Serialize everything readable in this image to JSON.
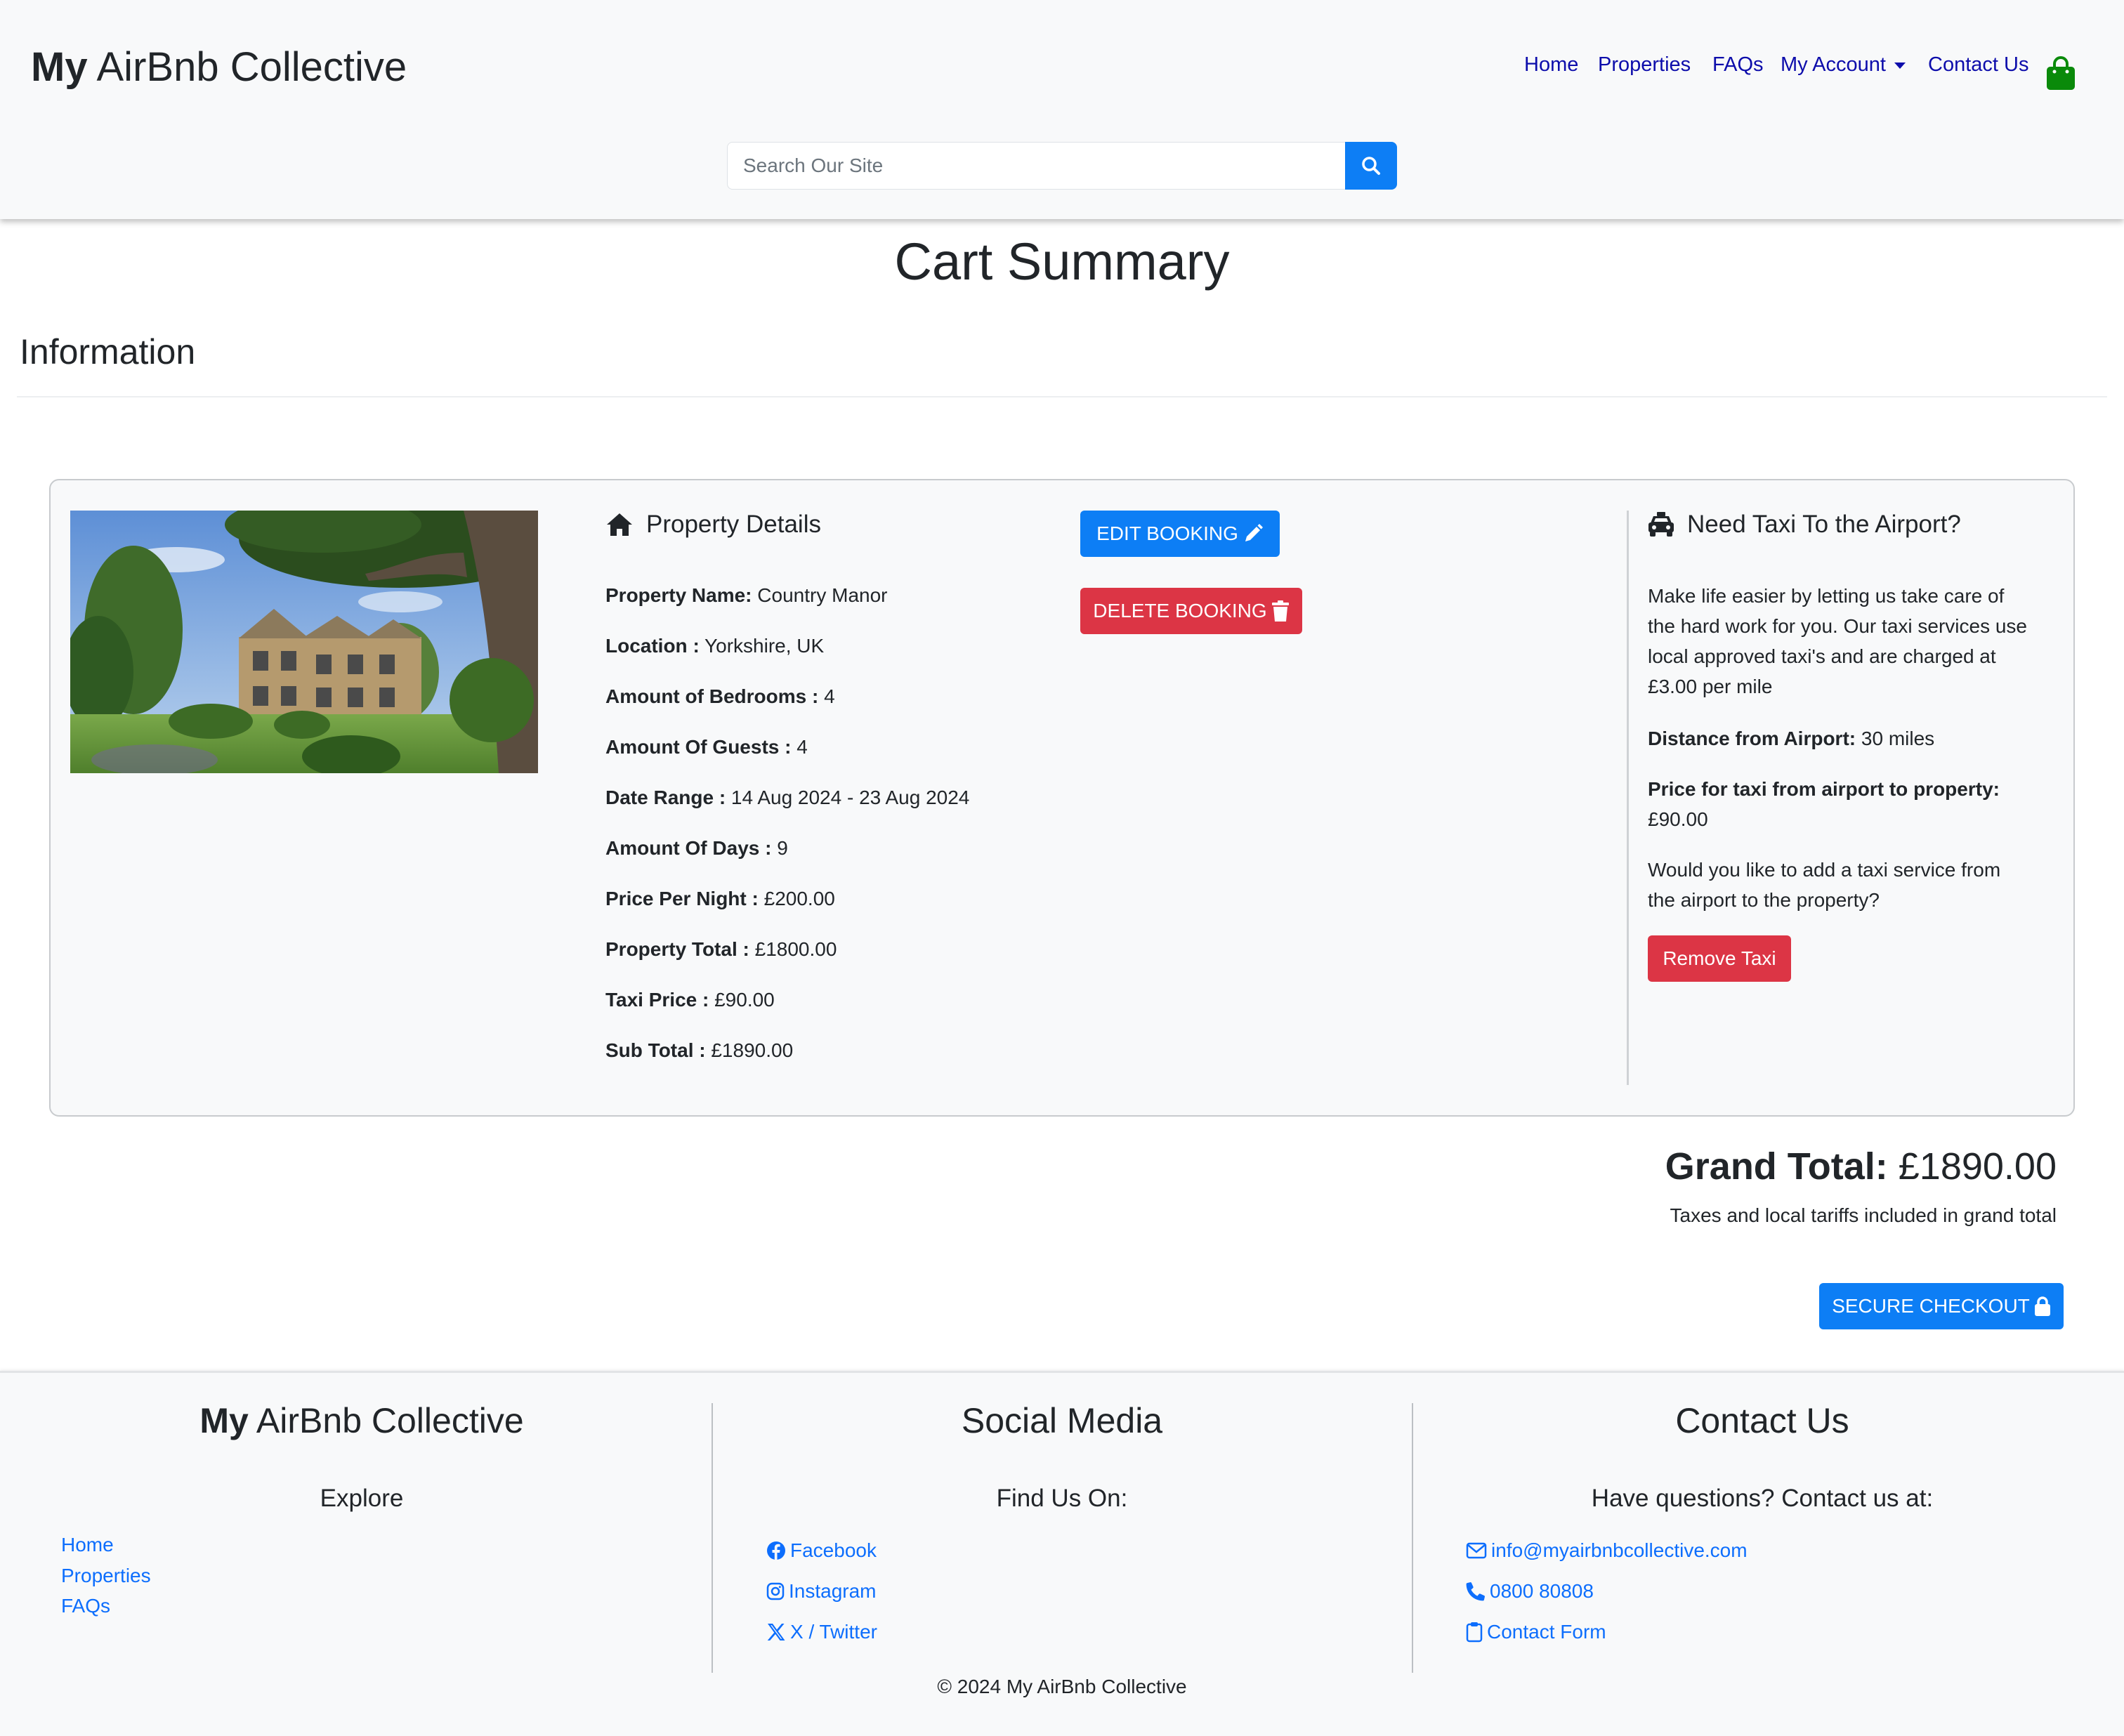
{
  "header": {
    "brand_bold": "My",
    "brand_rest": " AirBnb Collective",
    "nav": {
      "home": "Home",
      "properties": "Properties",
      "faqs": "FAQs",
      "account": "My Account",
      "contact": "Contact Us"
    },
    "search_placeholder": "Search Our Site",
    "cart_icon": "shopping-bag-icon",
    "cart_icon_color": "#0a8a0a"
  },
  "page": {
    "title": "Cart Summary",
    "section_heading": "Information"
  },
  "property": {
    "heading": "Property Details",
    "details": [
      {
        "label": "Property Name:",
        "value": " Country Manor"
      },
      {
        "label": "Location :",
        "value": " Yorkshire, UK"
      },
      {
        "label": "Amount of Bedrooms :",
        "value": " 4"
      },
      {
        "label": "Amount Of Guests :",
        "value": " 4"
      },
      {
        "label": "Date Range :",
        "value": " 14 Aug 2024 - 23 Aug 2024"
      },
      {
        "label": "Amount Of Days :",
        "value": " 9"
      },
      {
        "label": "Price Per Night :",
        "value": " £200.00"
      },
      {
        "label": "Property Total :",
        "value": " £1800.00"
      },
      {
        "label": "Taxi Price :",
        "value": " £90.00"
      },
      {
        "label": "Sub Total :",
        "value": " £1890.00"
      }
    ],
    "edit_button": "EDIT BOOKING",
    "delete_button": "DELETE BOOKING"
  },
  "taxi": {
    "heading": "Need Taxi To the Airport?",
    "intro": "Make life easier by letting us take care of the hard work for you. Our taxi services use local approved taxi's and are charged at £3.00 per mile",
    "distance_label": "Distance from Airport:",
    "distance_value": " 30 miles",
    "price_label": "Price for taxi from airport to property:",
    "price_value": "£90.00",
    "question": "Would you like to add a taxi service from the airport to the property?",
    "remove_button": "Remove Taxi"
  },
  "totals": {
    "grand_label": "Grand Total:",
    "grand_value": " £1890.00",
    "note": "Taxes and local tariffs included in grand total",
    "checkout_button": "SECURE CHECKOUT"
  },
  "footer": {
    "brand_bold": "My",
    "brand_rest": " AirBnb Collective",
    "explore": "Explore",
    "explore_links": [
      "Home",
      "Properties",
      "FAQs"
    ],
    "social_title": "Social Media",
    "social_sub": "Find Us On:",
    "social_links": [
      "Facebook",
      "Instagram",
      "X / Twitter"
    ],
    "contact_title": "Contact Us",
    "contact_sub": "Have questions? Contact us at:",
    "contact_links": [
      "info@myairbnbcollective.com",
      "0800 80808",
      "Contact Form"
    ],
    "copyright": "© 2024 My AirBnb Collective"
  },
  "colors": {
    "primary": "#0d7ef5",
    "danger": "#dc3545",
    "nav_link": "#0d0dab",
    "footer_link": "#0d6efd"
  }
}
